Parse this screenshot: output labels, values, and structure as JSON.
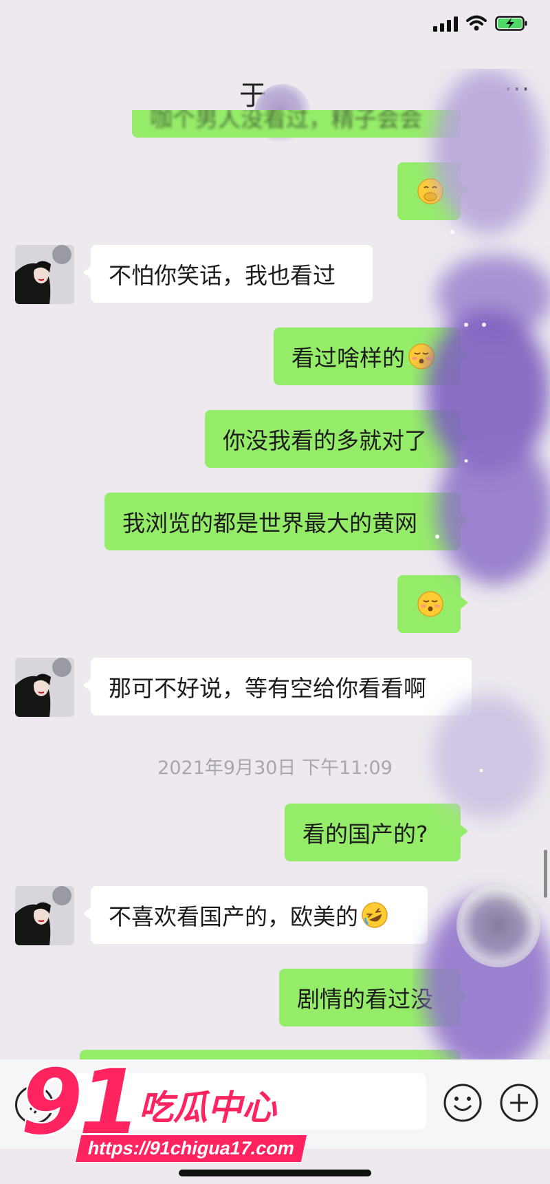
{
  "status_bar": {
    "icons": [
      "signal-icon",
      "wifi-icon",
      "battery-charging-icon"
    ]
  },
  "nav": {
    "title": "于",
    "more": "···"
  },
  "messages": [
    {
      "side": "mine",
      "text": "咖个男人没看过，精子会会",
      "partial": true
    },
    {
      "side": "mine",
      "text": "",
      "emoji": "face-hand-over-mouth"
    },
    {
      "side": "theirs",
      "text": "不怕你笑话，我也看过"
    },
    {
      "side": "mine",
      "text": "看过啥样的",
      "emoji": "kissing-face"
    },
    {
      "side": "mine",
      "text": "你没我看的多就对了"
    },
    {
      "side": "mine",
      "text": "我浏览的都是世界最大的黄网"
    },
    {
      "side": "mine",
      "text": "",
      "emoji": "kissing-face"
    },
    {
      "side": "theirs",
      "text": "那可不好说，等有空给你看看啊"
    },
    {
      "type": "timestamp",
      "text": "2021年9月30日 下午11:09"
    },
    {
      "side": "mine",
      "text": "看的国产的?"
    },
    {
      "side": "theirs",
      "text": "不喜欢看国产的，欧美的",
      "emoji": "rolling-laughing-face"
    },
    {
      "side": "mine",
      "text": "剧情的看过没"
    }
  ],
  "input_bar": {
    "icons": [
      "voice-icon",
      "emoji-icon",
      "plus-icon"
    ]
  },
  "watermark": {
    "number": "91",
    "name": "吃瓜中心",
    "url": "https://91chigua17.com"
  }
}
